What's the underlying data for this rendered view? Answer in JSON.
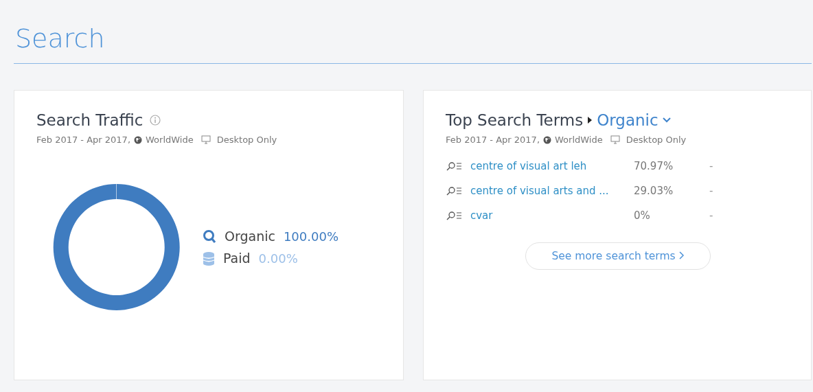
{
  "page": {
    "title": "Search"
  },
  "traffic": {
    "title": "Search Traffic",
    "period": "Feb 2017 - Apr 2017,",
    "region": "WorldWide",
    "device": "Desktop Only",
    "legend": [
      {
        "kind": "search",
        "label": "Organic",
        "share": "100.00%",
        "color": "#3f7cc0"
      },
      {
        "kind": "database",
        "label": "Paid",
        "share": "0.00%",
        "color": "#9dc0e8"
      }
    ]
  },
  "terms": {
    "title": "Top Search Terms",
    "filter": "Organic",
    "period": "Feb 2017 - Apr 2017,",
    "region": "WorldWide",
    "device": "Desktop Only",
    "rows": [
      {
        "term": "centre of visual art leh",
        "share": "70.97%",
        "change": "-"
      },
      {
        "term": "centre of visual arts and ...",
        "share": "29.03%",
        "change": "-"
      },
      {
        "term": "cvar",
        "share": "0%",
        "change": "-"
      }
    ],
    "more_button": "See more search terms"
  }
}
